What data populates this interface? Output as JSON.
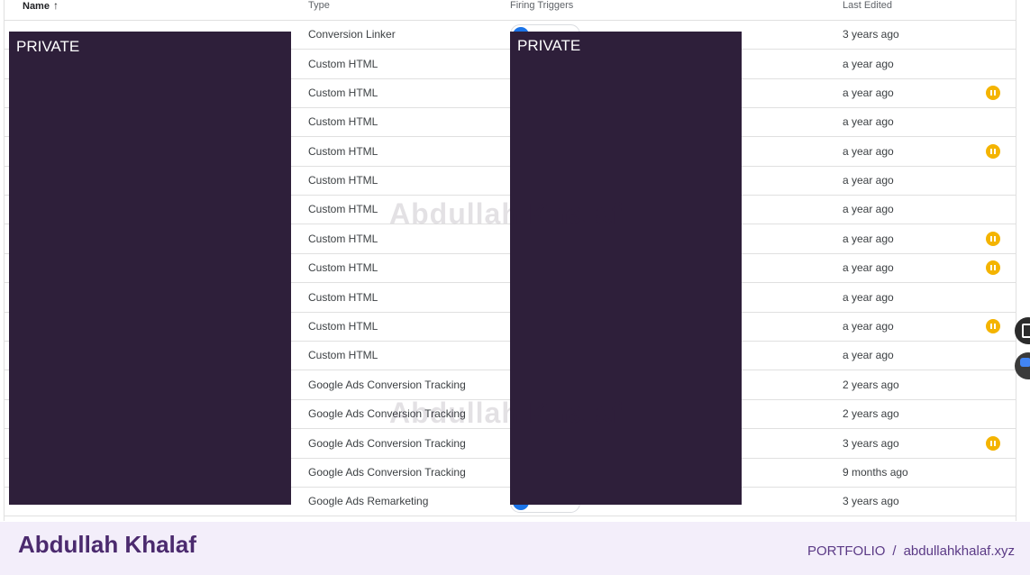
{
  "table": {
    "headers": {
      "name": "Name",
      "type": "Type",
      "triggers": "Firing Triggers",
      "last_edited": "Last Edited"
    },
    "rows": [
      {
        "type": "Conversion Linker",
        "last_edited": "3 years ago",
        "paused": false
      },
      {
        "type": "Custom HTML",
        "last_edited": "a year ago",
        "paused": false
      },
      {
        "type": "Custom HTML",
        "last_edited": "a year ago",
        "paused": true
      },
      {
        "type": "Custom HTML",
        "last_edited": "a year ago",
        "paused": false
      },
      {
        "type": "Custom HTML",
        "last_edited": "a year ago",
        "paused": true
      },
      {
        "type": "Custom HTML",
        "last_edited": "a year ago",
        "paused": false
      },
      {
        "type": "Custom HTML",
        "last_edited": "a year ago",
        "paused": false
      },
      {
        "type": "Custom HTML",
        "last_edited": "a year ago",
        "paused": true
      },
      {
        "type": "Custom HTML",
        "last_edited": "a year ago",
        "paused": true
      },
      {
        "type": "Custom HTML",
        "last_edited": "a year ago",
        "paused": false
      },
      {
        "type": "Custom HTML",
        "last_edited": "a year ago",
        "paused": true
      },
      {
        "type": "Custom HTML",
        "last_edited": "a year ago",
        "paused": false
      },
      {
        "type": "Google Ads Conversion Tracking",
        "last_edited": "2 years ago",
        "paused": false
      },
      {
        "type": "Google Ads Conversion Tracking",
        "last_edited": "2 years ago",
        "paused": false
      },
      {
        "type": "Google Ads Conversion Tracking",
        "last_edited": "3 years ago",
        "paused": true
      },
      {
        "type": "Google Ads Conversion Tracking",
        "last_edited": "9 months ago",
        "paused": false
      },
      {
        "type": "Google Ads Remarketing",
        "last_edited": "3 years ago",
        "paused": false
      }
    ]
  },
  "redactions": {
    "left_label": "PRIVATE",
    "right_label": "PRIVATE"
  },
  "watermark": {
    "text": "Abdullah Khalaf"
  },
  "footer": {
    "brand": "Abdullah Khalaf",
    "portfolio_label": "PORTFOLIO",
    "separator": "/",
    "site": "abdullahkhalaf.xyz"
  },
  "icons": {
    "sort": "arrow-up-icon",
    "paused": "pause-icon",
    "trigger": "trigger-dot-icon"
  },
  "colors": {
    "redaction": "#2e1f3a",
    "paused_badge": "#f4b400",
    "trigger_dot": "#1a73e8",
    "footer_bg": "#f3eefa",
    "brand": "#4b2a6e"
  }
}
